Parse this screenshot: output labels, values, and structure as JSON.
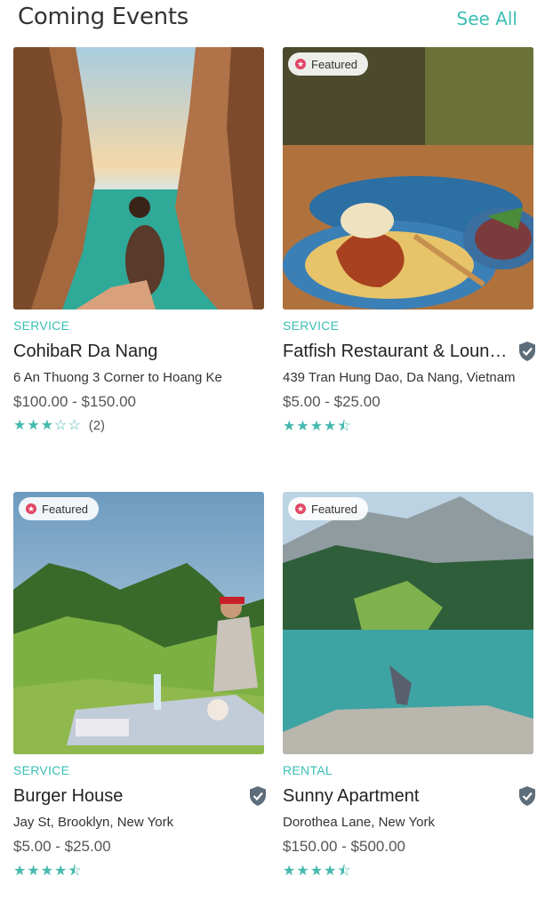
{
  "header": {
    "title": "Coming Events",
    "see_all": "See All"
  },
  "cards": [
    {
      "category": "SERVICE",
      "name": "CohibaR Da Nang",
      "address": "6 An Thuong 3 Corner to Hoang Ke",
      "price": "$100.00 - $150.00",
      "stars": "★★★☆☆",
      "rating_value": 3,
      "review_count": "(2)",
      "featured": false,
      "verified": false
    },
    {
      "category": "SERVICE",
      "name": "Fatfish Restaurant & Lounge Bar",
      "address": "439 Tran Hung Dao, Da Nang, Vietnam",
      "price": "$5.00 - $25.00",
      "stars": "★★★★⯪",
      "rating_value": 4.5,
      "featured": true,
      "featured_label": "Featured",
      "verified": true
    },
    {
      "category": "SERVICE",
      "name": "Burger House",
      "address": "Jay St, Brooklyn, New York",
      "price": "$5.00 - $25.00",
      "stars": "★★★★⯪",
      "rating_value": 4.5,
      "featured": true,
      "featured_label": "Featured",
      "verified": true
    },
    {
      "category": "RENTAL",
      "name": "Sunny Apartment",
      "address": "Dorothea Lane, New York",
      "price": "$150.00 - $500.00",
      "stars": "★★★★⯪",
      "rating_value": 4.5,
      "featured": true,
      "featured_label": "Featured",
      "verified": true
    }
  ],
  "colors": {
    "accent": "#3bbfb4",
    "star": "#45b9ad",
    "featured_dot": "#e24664",
    "shield": "#5d6d7a"
  }
}
